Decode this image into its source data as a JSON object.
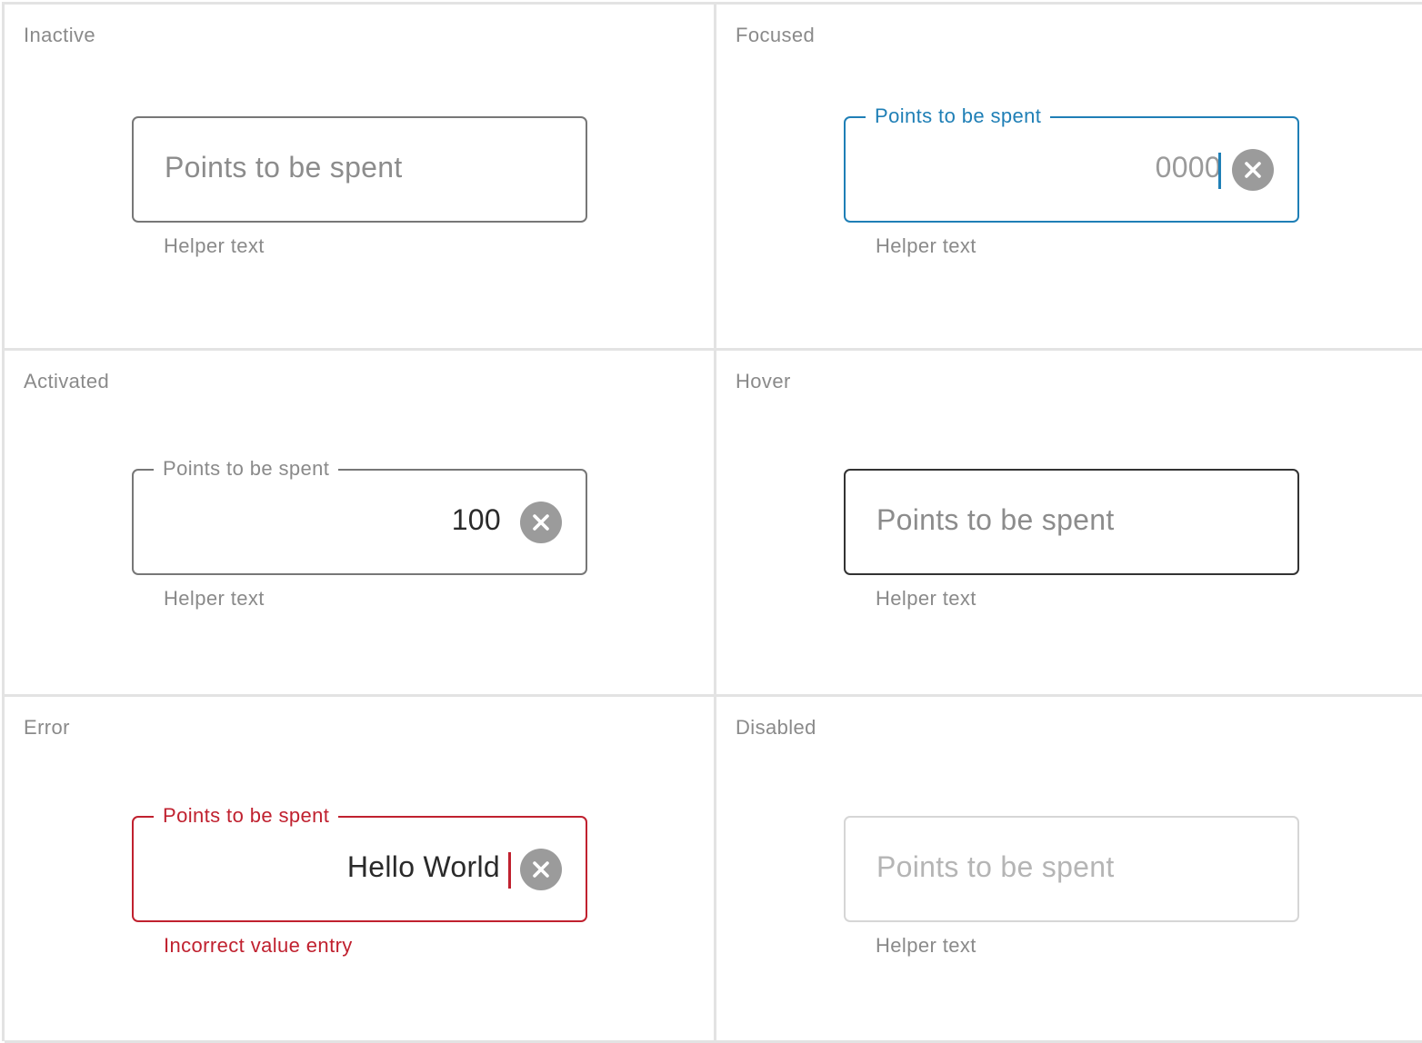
{
  "colors": {
    "focus_accent": "#1f7fb6",
    "error_accent": "#c0212f",
    "hover_border": "#333333",
    "disabled_border": "#d6d6d6",
    "default_border": "#777777"
  },
  "icons": {
    "clear": "clear-circle-x-icon"
  },
  "states": {
    "inactive": {
      "title": "Inactive",
      "placeholder": "Points to be spent",
      "helper": "Helper text"
    },
    "focused": {
      "title": "Focused",
      "label": "Points to be spent",
      "value_placeholder": "0000",
      "helper": "Helper text"
    },
    "activated": {
      "title": "Activated",
      "label": "Points to be spent",
      "value": "100",
      "helper": "Helper text"
    },
    "hover": {
      "title": "Hover",
      "placeholder": "Points to be spent",
      "helper": "Helper text"
    },
    "error": {
      "title": "Error",
      "label": "Points to be spent",
      "value": "Hello World",
      "error_message": "Incorrect value entry"
    },
    "disabled": {
      "title": "Disabled",
      "placeholder": "Points to be spent",
      "helper": "Helper text"
    }
  }
}
